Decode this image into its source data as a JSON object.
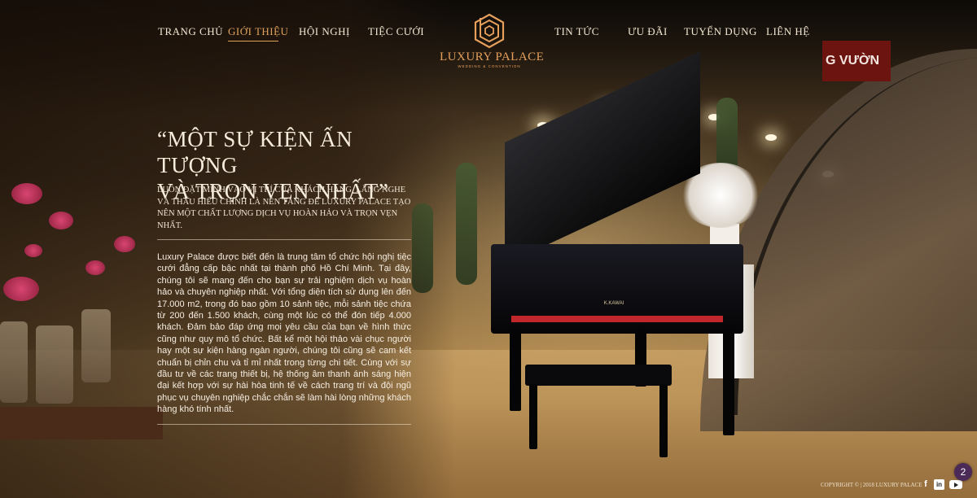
{
  "nav": {
    "left": [
      {
        "label": "TRANG CHỦ"
      },
      {
        "label": "GIỚI THIỆU",
        "active": true
      },
      {
        "label": "HỘI NGHỊ"
      },
      {
        "label": "TIỆC CƯỚI"
      }
    ],
    "right": [
      {
        "label": "TIN TỨC"
      },
      {
        "label": "ƯU ĐÃI"
      },
      {
        "label": "TUYỂN DỤNG"
      },
      {
        "label": "LIÊN HỆ"
      }
    ]
  },
  "logo": {
    "name": "LUXURY PALACE",
    "tagline": "WEDDING & CONVENTION",
    "icon": "hexagon-logo-icon"
  },
  "intro": {
    "headline_line1": "“MỘT SỰ KIỆN ẤN TƯỢNG",
    "headline_line2": "VÀ TRỌN VẸN NHẤT”",
    "subheadline": "Luôn đặt mình vào vị trí của khách hàng, lắng nghe và thấu hiểu chính là nền tảng để Luxury Palace tạo nên một chất lượng dịch vụ hoàn hảo và trọn vẹn nhất.",
    "body": "Luxury Palace được biết đến là trung tâm tổ chức hội nghị tiệc cưới đẳng cấp bậc nhất tại thành phố Hồ Chí Minh. Tại đây, chúng tôi sẽ mang đến cho bạn sự trải nghiệm dịch vụ hoàn hảo và chuyên nghiệp nhất. Với tổng diện tích sử dụng lên đến 17.000 m2, trong đó bao gồm 10 sảnh tiệc, mỗi sảnh tiệc chứa từ 200 đến 1.500 khách, cùng một lúc có thể đón tiếp 4.000 khách. Đảm bảo đáp ứng mọi yêu cầu của bạn về hình thức cũng như quy mô tổ chức. Bất kể một hội thảo vài chục người hay một sự kiện hàng ngàn người, chúng tôi cũng sẽ cam kết chuẩn bị chỉn chu và tỉ mỉ nhất trong từng chi tiết. Cùng với sự đầu tư về các trang thiết bị, hệ thống âm thanh ánh sáng hiện đại kết hợp với sự hài hòa tinh tế về cách trang trí và đội ngũ phục vụ chuyên nghiệp chắc chắn sẽ làm hài lòng những khách hàng khó tính nhất."
  },
  "background": {
    "piano_brand": "K.KAWAI",
    "sign_text": "G VƯỜN"
  },
  "footer": {
    "copyright": "COPYRIGHT © | 2018 LUXURY PALACE",
    "social": [
      "facebook-icon",
      "linkedin-icon",
      "youtube-icon"
    ]
  },
  "chat_badge": {
    "count": "2"
  },
  "colors": {
    "accent": "#e0a35c",
    "text": "#f3e7d2",
    "badge": "#4b2a58"
  }
}
